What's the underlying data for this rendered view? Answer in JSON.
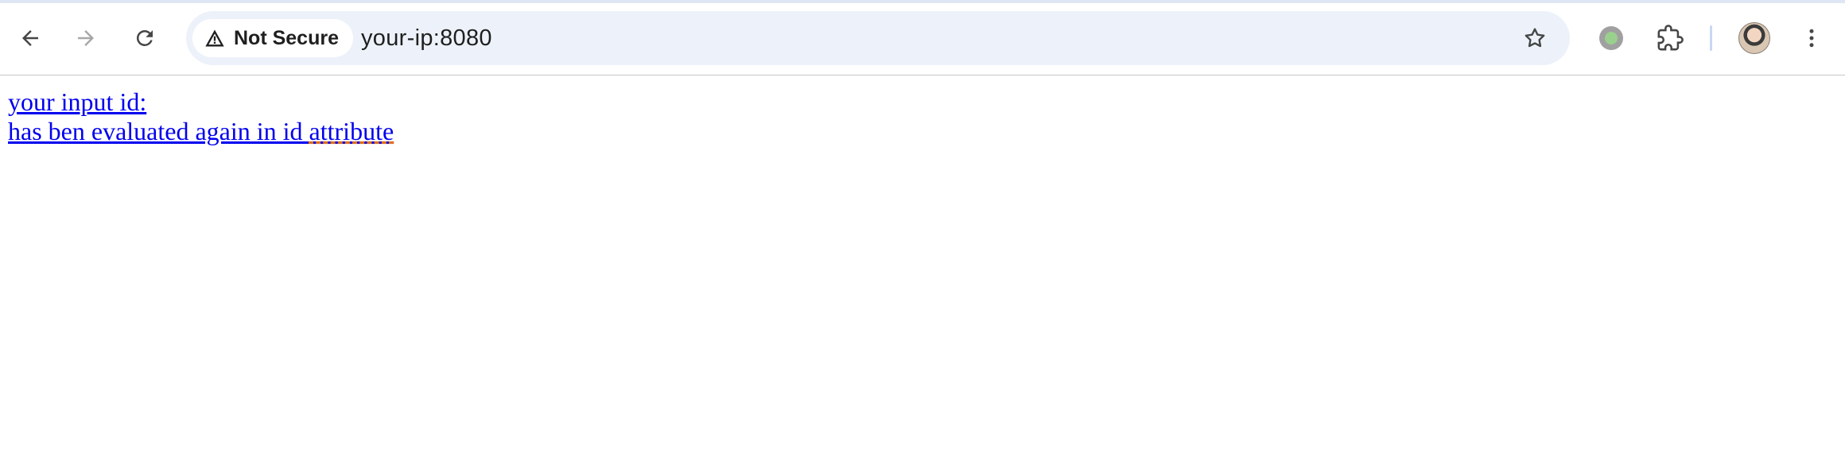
{
  "browser": {
    "security_label": "Not Secure",
    "url": "your-ip:8080",
    "icons": {
      "back": "arrow-left-icon",
      "forward": "arrow-right-icon",
      "reload": "reload-icon",
      "warning": "warning-triangle-icon",
      "bookmark": "star-icon",
      "extension_status": "status-dot-icon",
      "extensions": "puzzle-icon",
      "profile": "avatar-icon",
      "menu": "kebab-menu-icon"
    }
  },
  "page": {
    "line1": "your input id:",
    "line2_prefix": "has ben evaluated again in id ",
    "line2_word": "attribute",
    "link_color": "#0000ee"
  }
}
